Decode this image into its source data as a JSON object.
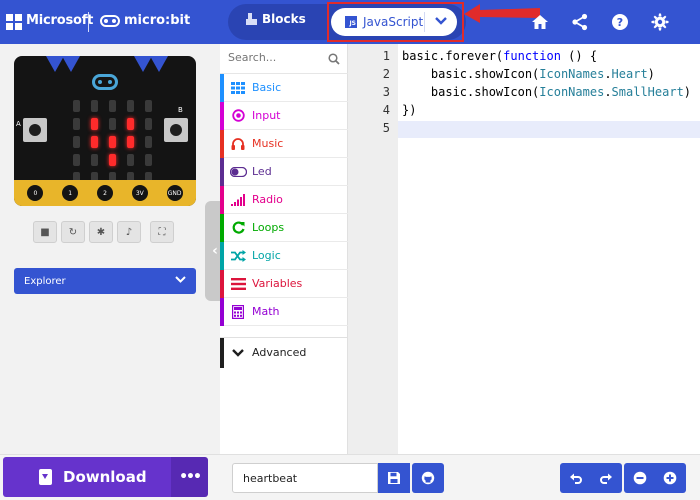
{
  "header": {
    "microsoft_label": "Microsoft",
    "microbit_label": "micro:bit",
    "tabs": {
      "blocks": "Blocks",
      "javascript": "JavaScript",
      "js_badge": "JS"
    },
    "icons": [
      "home-icon",
      "share-icon",
      "help-icon",
      "settings-icon"
    ],
    "accent_color": "#3454d1",
    "highlight_color": "#e02b2b"
  },
  "simulator": {
    "pin_labels": [
      "0",
      "1",
      "2",
      "3V",
      "GND"
    ],
    "button_labels": [
      "A",
      "B"
    ],
    "led_matrix": [
      [
        0,
        0,
        0,
        0,
        0
      ],
      [
        0,
        1,
        0,
        1,
        0
      ],
      [
        0,
        1,
        1,
        1,
        0
      ],
      [
        0,
        0,
        1,
        0,
        0
      ],
      [
        0,
        0,
        0,
        0,
        0
      ]
    ],
    "controls": [
      "stop-icon",
      "restart-icon",
      "debug-icon",
      "mute-icon",
      "fullscreen-icon"
    ],
    "explorer_label": "Explorer"
  },
  "toolbox": {
    "search_placeholder": "Search...",
    "categories": [
      {
        "label": "Basic",
        "color": "#1e90ff",
        "icon": "grid-icon"
      },
      {
        "label": "Input",
        "color": "#d400d4",
        "icon": "target-icon"
      },
      {
        "label": "Music",
        "color": "#e63022",
        "icon": "headphones-icon"
      },
      {
        "label": "Led",
        "color": "#5c2d91",
        "icon": "toggle-icon"
      },
      {
        "label": "Radio",
        "color": "#e3008c",
        "icon": "signal-icon"
      },
      {
        "label": "Loops",
        "color": "#00aa00",
        "icon": "loop-icon"
      },
      {
        "label": "Logic",
        "color": "#00a4a6",
        "icon": "shuffle-icon"
      },
      {
        "label": "Variables",
        "color": "#dc143c",
        "icon": "list-icon"
      },
      {
        "label": "Math",
        "color": "#9400d3",
        "icon": "calculator-icon"
      }
    ],
    "advanced_label": "Advanced"
  },
  "editor": {
    "line_numbers": [
      "1",
      "2",
      "3",
      "4",
      "5"
    ],
    "line1": {
      "a": "basic.forever(",
      "kw": "function",
      "b": " () {"
    },
    "line2": {
      "a": "    basic.showIcon(",
      "enum": "IconNames",
      "b": ".",
      "val": "Heart",
      "c": ")"
    },
    "line3": {
      "a": "    basic.showIcon(",
      "enum": "IconNames",
      "b": ".",
      "val": "SmallHeart",
      "c": ")"
    },
    "line4": "})"
  },
  "footer": {
    "download_label": "Download",
    "more_label": "•••",
    "project_name": "heartbeat",
    "download_color": "#6633cc"
  }
}
